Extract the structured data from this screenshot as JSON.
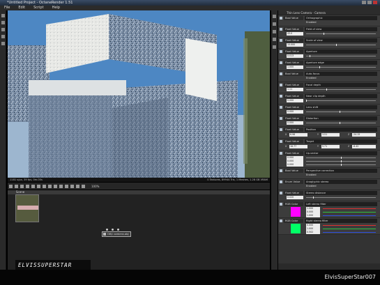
{
  "window": {
    "title": "*Untitled Project - OctaneRender 1.51"
  },
  "menu": [
    "File",
    "Edit",
    "Script",
    "Help"
  ],
  "render": {
    "status_left": "1181 s/px, 39 fps, 0m.05s",
    "status_right": "0 Textures, 89944 Tris, 1 Meshes, 1.28 GB VRAM"
  },
  "toolbar": {
    "zoom": "100%"
  },
  "nodegraph": {
    "tab": "Scene",
    "node_label": "OBJ: camera.obj"
  },
  "logo": {
    "text": "ELVISSUPERSTAR"
  },
  "inspector": {
    "header": "Thin Lens Camera - Camera",
    "rows": [
      {
        "type": "Bool Value",
        "label": "Orthographic",
        "sub": "Enabled",
        "kind": "bool"
      },
      {
        "type": "Float Value",
        "label": "Field of view",
        "value": "43.0",
        "fill": 0.26,
        "kind": "float"
      },
      {
        "type": "Float Value",
        "label": "Scale of view",
        "value": "10.000",
        "fill": 0.45,
        "kind": "float"
      },
      {
        "type": "Float Value",
        "label": "Aperture",
        "value": "0.013",
        "fill": 0.05,
        "kind": "float"
      },
      {
        "type": "Float Value",
        "label": "Aperture edge",
        "value": "1.000",
        "fill": 0.2,
        "kind": "float"
      },
      {
        "type": "Bool Value",
        "label": "Auto-focus",
        "sub": "Enabled",
        "kind": "bool"
      },
      {
        "type": "Float Value",
        "label": "Focal depth",
        "value": "1.11",
        "fill": 0.3,
        "kind": "float"
      },
      {
        "type": "Float Value",
        "label": "Near clip depth",
        "value": "0.000",
        "fill": 0.0,
        "kind": "float"
      },
      {
        "type": "Float Value",
        "label": "Lens shift",
        "value": "0.000",
        "fill": 0.5,
        "kind": "float2"
      },
      {
        "type": "Float Value",
        "label": "Distortion",
        "value": "0.000",
        "fill": 0.5,
        "kind": "float"
      },
      {
        "type": "Float Value",
        "label": "Position",
        "x": "6.98",
        "y": "3.51",
        "z": "-24.15",
        "kind": "xyz"
      },
      {
        "type": "Float Value",
        "label": "Target",
        "x": "16.77",
        "y": "5.71",
        "z": "-6.42",
        "kind": "xyz"
      },
      {
        "type": "Float Value",
        "label": "Up-vector",
        "value": "0.000",
        "fill": 0.5,
        "kind": "tri"
      },
      {
        "type": "Bool Value",
        "label": "Perspective correction",
        "sub": "Enabled",
        "kind": "bool"
      },
      {
        "type": "Enum Value",
        "label": "Anaglyphic stereo",
        "sub": "Enabled",
        "kind": "bool"
      },
      {
        "type": "Float Value",
        "label": "Stereo distance",
        "value": "0.020",
        "fill": 0.1,
        "kind": "float"
      },
      {
        "type": "RGB Color",
        "label": "Left stereo filter",
        "color": "#ff00ff",
        "v1": "1.000",
        "v2": "0.000",
        "v3": "1.000",
        "kind": "rgb"
      },
      {
        "type": "RGB Color",
        "label": "Right stereo filter",
        "color": "#00ff66",
        "v1": "0.000",
        "v2": "1.000",
        "v3": "0.502",
        "kind": "rgb"
      }
    ]
  },
  "footer": {
    "username": "ElvisSuperStar007"
  }
}
